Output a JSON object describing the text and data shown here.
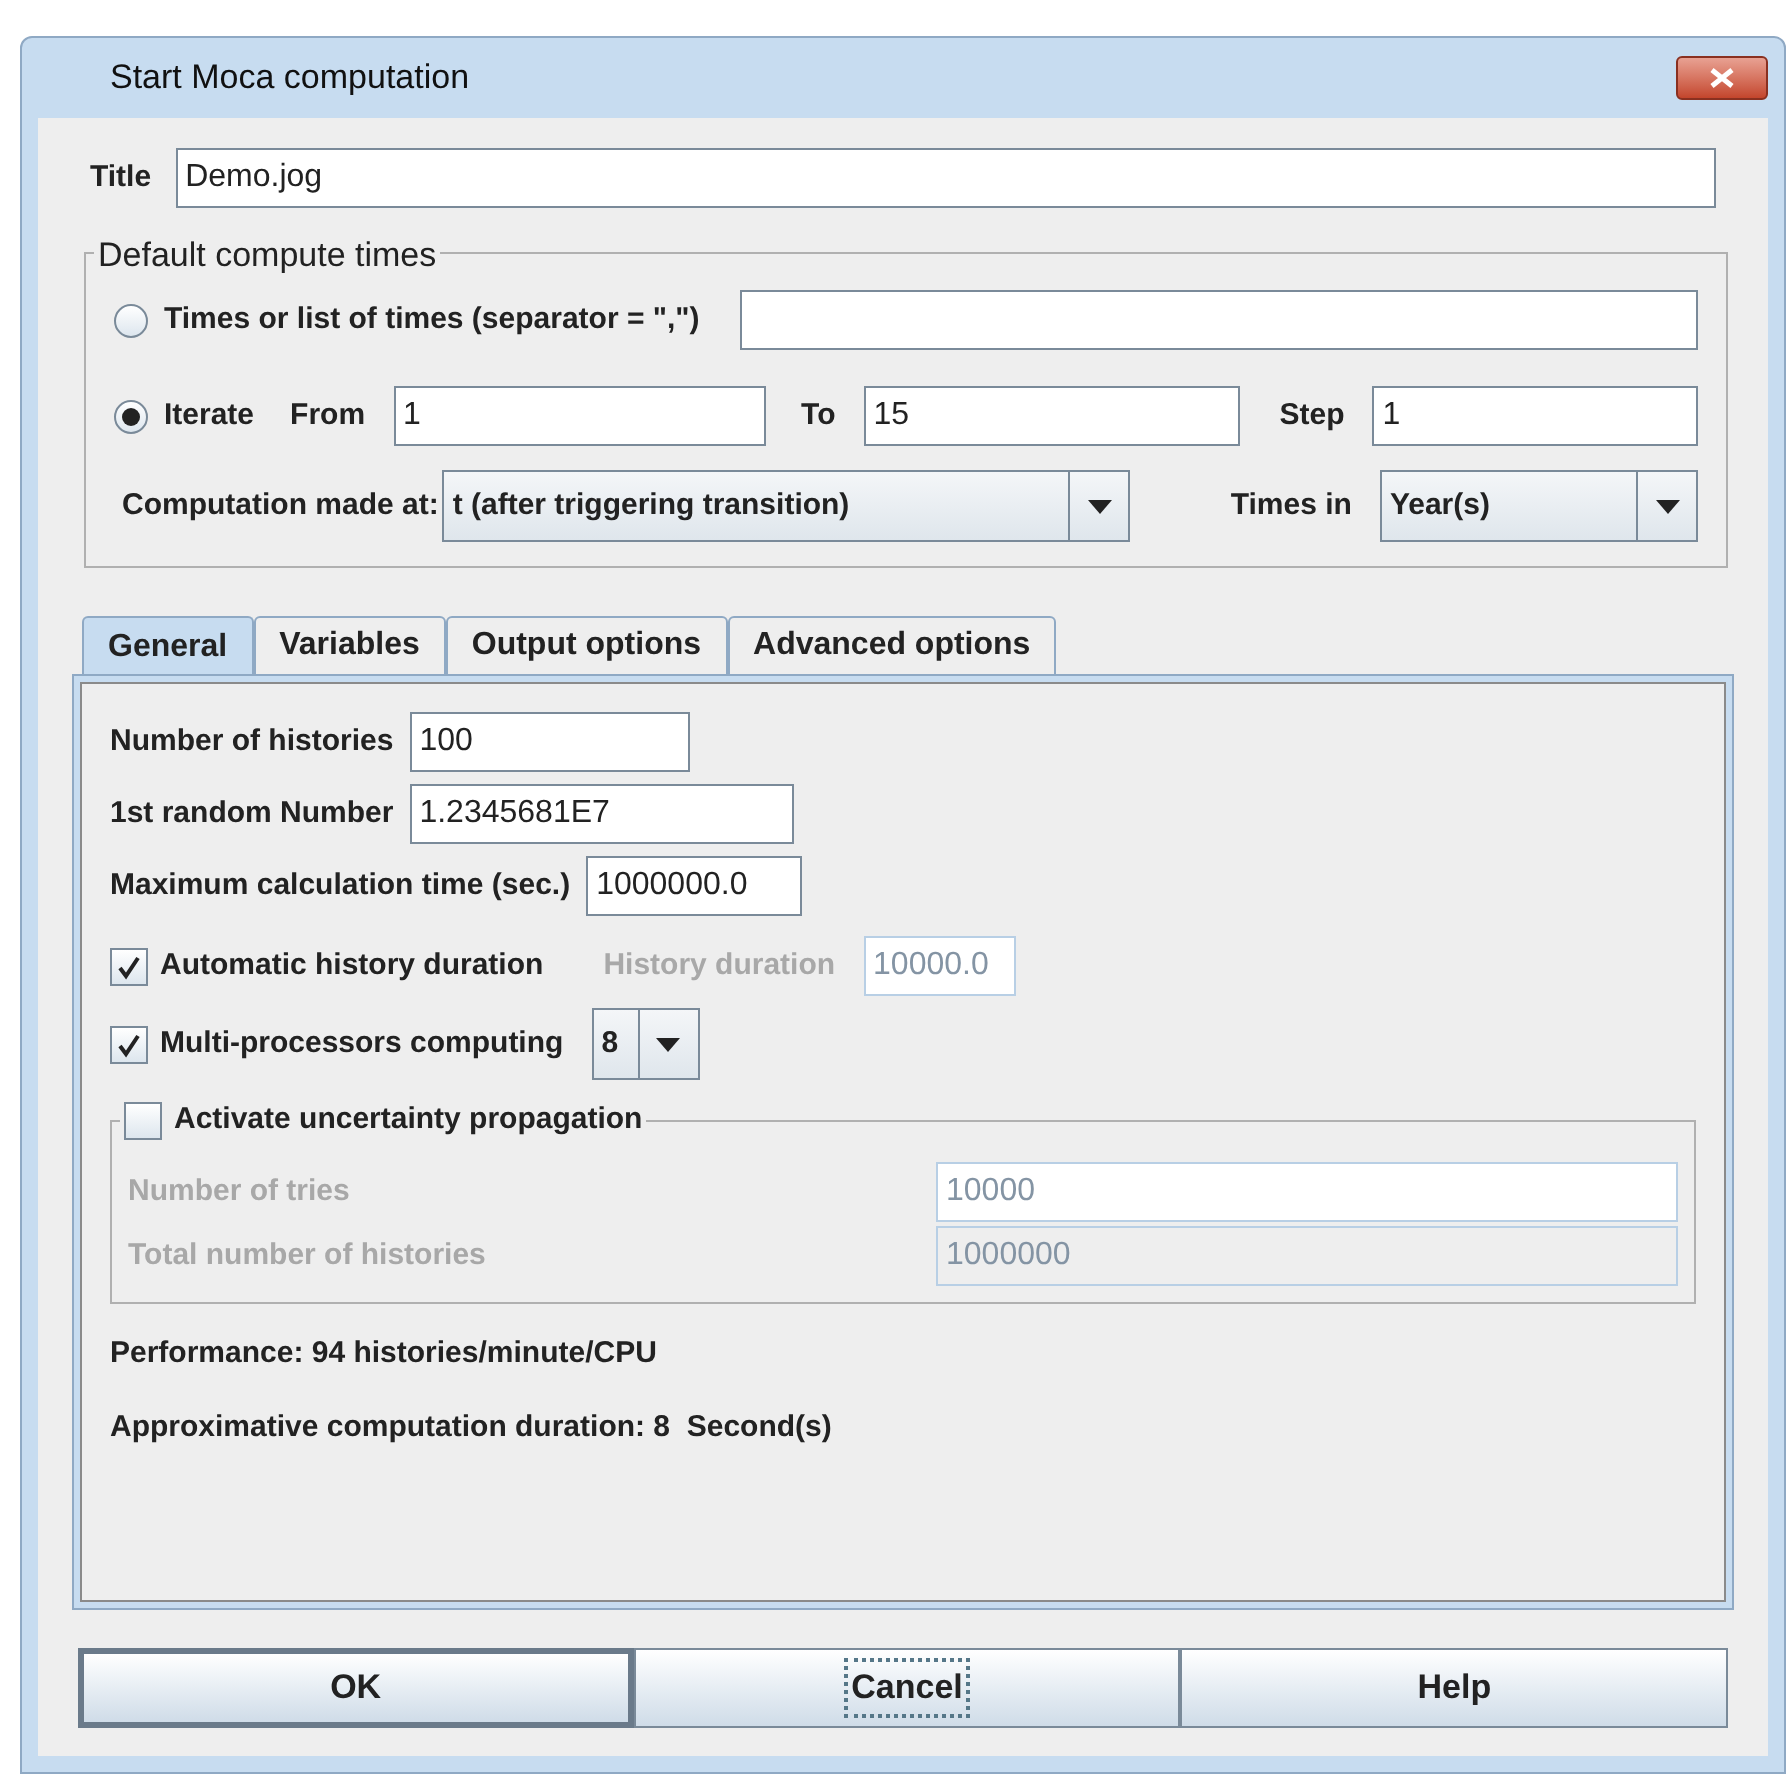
{
  "window": {
    "title": "Start Moca computation"
  },
  "title_field": {
    "label": "Title",
    "value": "Demo.jog"
  },
  "compute_times": {
    "legend": "Default compute times",
    "options": [
      {
        "kind": "list",
        "label": "Times or list of times (separator = \",\")",
        "selected": false
      },
      {
        "kind": "iterate",
        "label": "Iterate",
        "selected": true,
        "from_label": "From",
        "from": "1",
        "to_label": "To",
        "to": "15",
        "step_label": "Step",
        "step": "1"
      }
    ],
    "computation_at": {
      "label": "Computation made at:",
      "value": "t (after triggering transition)"
    },
    "times_in": {
      "label": "Times in",
      "value": "Year(s)"
    }
  },
  "tabs": [
    {
      "label": "General",
      "selected": true
    },
    {
      "label": "Variables",
      "selected": false
    },
    {
      "label": "Output options",
      "selected": false
    },
    {
      "label": "Advanced options",
      "selected": false
    }
  ],
  "general": {
    "fields": [
      {
        "label": "Number of histories",
        "value": "100"
      },
      {
        "label": "1st random Number",
        "value": "1.2345681E7"
      },
      {
        "label": "Maximum calculation time (sec.)",
        "value": "1000000.0"
      }
    ],
    "auto_duration": {
      "label": "Automatic history duration",
      "checked": true,
      "field_label": "History duration",
      "value": "10000.0",
      "field_disabled": true
    },
    "multi": {
      "label": "Multi-processors computing",
      "checked": true,
      "value": "8"
    },
    "uncertainty": {
      "label": "Activate uncertainty propagation",
      "checked": false,
      "rows": [
        {
          "label": "Number of tries",
          "value": "10000",
          "disabled": true
        },
        {
          "label": "Total number of histories",
          "value": "1000000",
          "disabled": true
        }
      ]
    },
    "performance": "Performance: 94 histories/minute/CPU",
    "duration": "Approximative computation duration: 8  Second(s)"
  },
  "buttons": [
    {
      "label": "OK",
      "default": true,
      "focused": false
    },
    {
      "label": "Cancel",
      "default": false,
      "focused": true
    },
    {
      "label": "Help",
      "default": false,
      "focused": false
    }
  ]
}
